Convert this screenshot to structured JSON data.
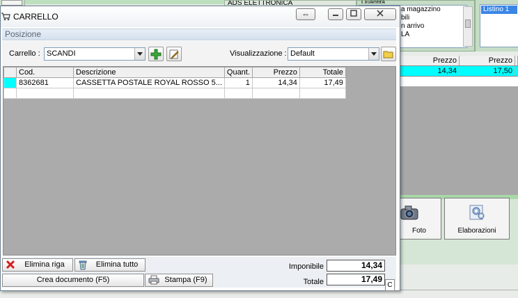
{
  "background": {
    "ads_title": "ADS ELETTRONICA",
    "quantita": {
      "header": "Quantità",
      "items": [
        "a magazzino",
        "bili",
        "n arrivo",
        "LA"
      ]
    },
    "listino": {
      "selected": "Listino 1"
    },
    "grid": {
      "headers": [
        "Prezzo",
        "Prezzo"
      ],
      "row": [
        "14,34",
        "17,50"
      ]
    },
    "buttons": {
      "foto_label": "Foto",
      "elaborazioni_label": "Elaborazioni"
    }
  },
  "window": {
    "title": "CARRELLO",
    "section_title": "Posizione"
  },
  "toolbar": {
    "carrello_label": "Carrello :",
    "carrello_value": "SCANDI",
    "visualizzazione_label": "Visualizzazione :",
    "visualizzazione_value": "Default"
  },
  "cart_table": {
    "headers": {
      "cod": "Cod.",
      "descrizione": "Descrizione",
      "quant": "Quant.",
      "prezzo": "Prezzo",
      "totale": "Totale"
    },
    "rows": [
      {
        "cod": "8362681",
        "descrizione": "CASSETTA POSTALE ROYAL ROSSO 5...",
        "quant": "1",
        "prezzo": "14,34",
        "totale": "17,49"
      }
    ]
  },
  "actions": {
    "elimina_riga": "Elimina riga",
    "elimina_tutto": "Elimina tutto",
    "crea_documento": "Crea documento (F5)",
    "stampa": "Stampa (F9)"
  },
  "totals": {
    "imponibile_label": "Imponibile",
    "imponibile_value": "14,34",
    "totale_label": "Totale",
    "totale_value": "17,49",
    "currency_button": "C"
  },
  "colors": {
    "selected_row": "#00ffff",
    "grid_empty": "#ababab",
    "accent_blue": "#3a86e6"
  }
}
